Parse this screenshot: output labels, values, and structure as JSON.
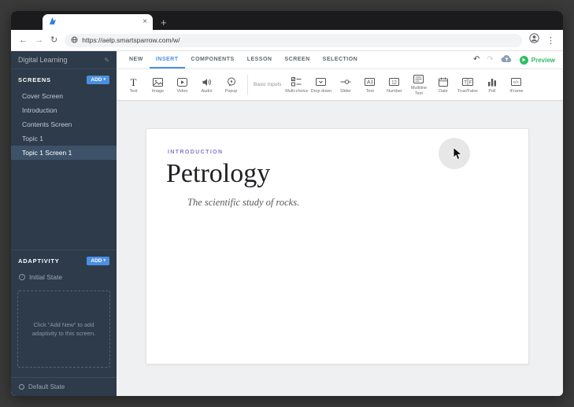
{
  "browser": {
    "url": "https://aelp.smartsparrow.com/w/",
    "tab_close": "×",
    "new_tab_label": "+",
    "back": "←",
    "forward": "→",
    "refresh": "↻",
    "kebab": "⋮"
  },
  "sidebar": {
    "title": "Digital Learning",
    "screens": {
      "heading": "SCREENS",
      "add_label": "ADD",
      "add_caret": "▾",
      "items": [
        {
          "label": "Cover Screen"
        },
        {
          "label": "Introduction"
        },
        {
          "label": "Contents Screen"
        },
        {
          "label": "Topic 1"
        },
        {
          "label": "Topic 1 Screen 1"
        }
      ],
      "selected_index": 4
    },
    "adaptivity": {
      "heading": "ADAPTIVITY",
      "add_label": "ADD",
      "add_caret": "▾",
      "initial_state_label": "Initial State",
      "empty_hint": "Click \"Add New\" to add adaptivity to this screen."
    },
    "footer_label": "Default State"
  },
  "menubar": {
    "tabs": [
      {
        "label": "NEW"
      },
      {
        "label": "INSERT"
      },
      {
        "label": "COMPONENTS"
      },
      {
        "label": "LESSON"
      },
      {
        "label": "SCREEN"
      },
      {
        "label": "SELECTION"
      }
    ],
    "active_tab": "INSERT",
    "undo": "↶",
    "redo": "↷",
    "preview_label": "Preview"
  },
  "toolbar": {
    "media_tools": [
      {
        "label": "Text"
      },
      {
        "label": "Image"
      },
      {
        "label": "Video"
      },
      {
        "label": "Audio"
      },
      {
        "label": "Popup"
      }
    ],
    "group_label": "Basic Inputs",
    "input_tools": [
      {
        "label": "Multi-choice"
      },
      {
        "label": "Drop down"
      },
      {
        "label": "Slider"
      },
      {
        "label": "Text"
      },
      {
        "label": "Number"
      },
      {
        "label": "Multiline Text"
      },
      {
        "label": "Date"
      },
      {
        "label": "True/False"
      },
      {
        "label": "Poll"
      },
      {
        "label": "iFrame"
      }
    ]
  },
  "canvas": {
    "kicker": "INTRODUCTION",
    "title": "Petrology",
    "subtitle": "The scientific study of rocks."
  },
  "colors": {
    "accent_blue": "#4a90e2",
    "kicker_purple": "#8678d2",
    "preview_green": "#2fbd62",
    "sidebar_bg": "#2d3b4b",
    "sidebar_selected": "#3d5269"
  }
}
